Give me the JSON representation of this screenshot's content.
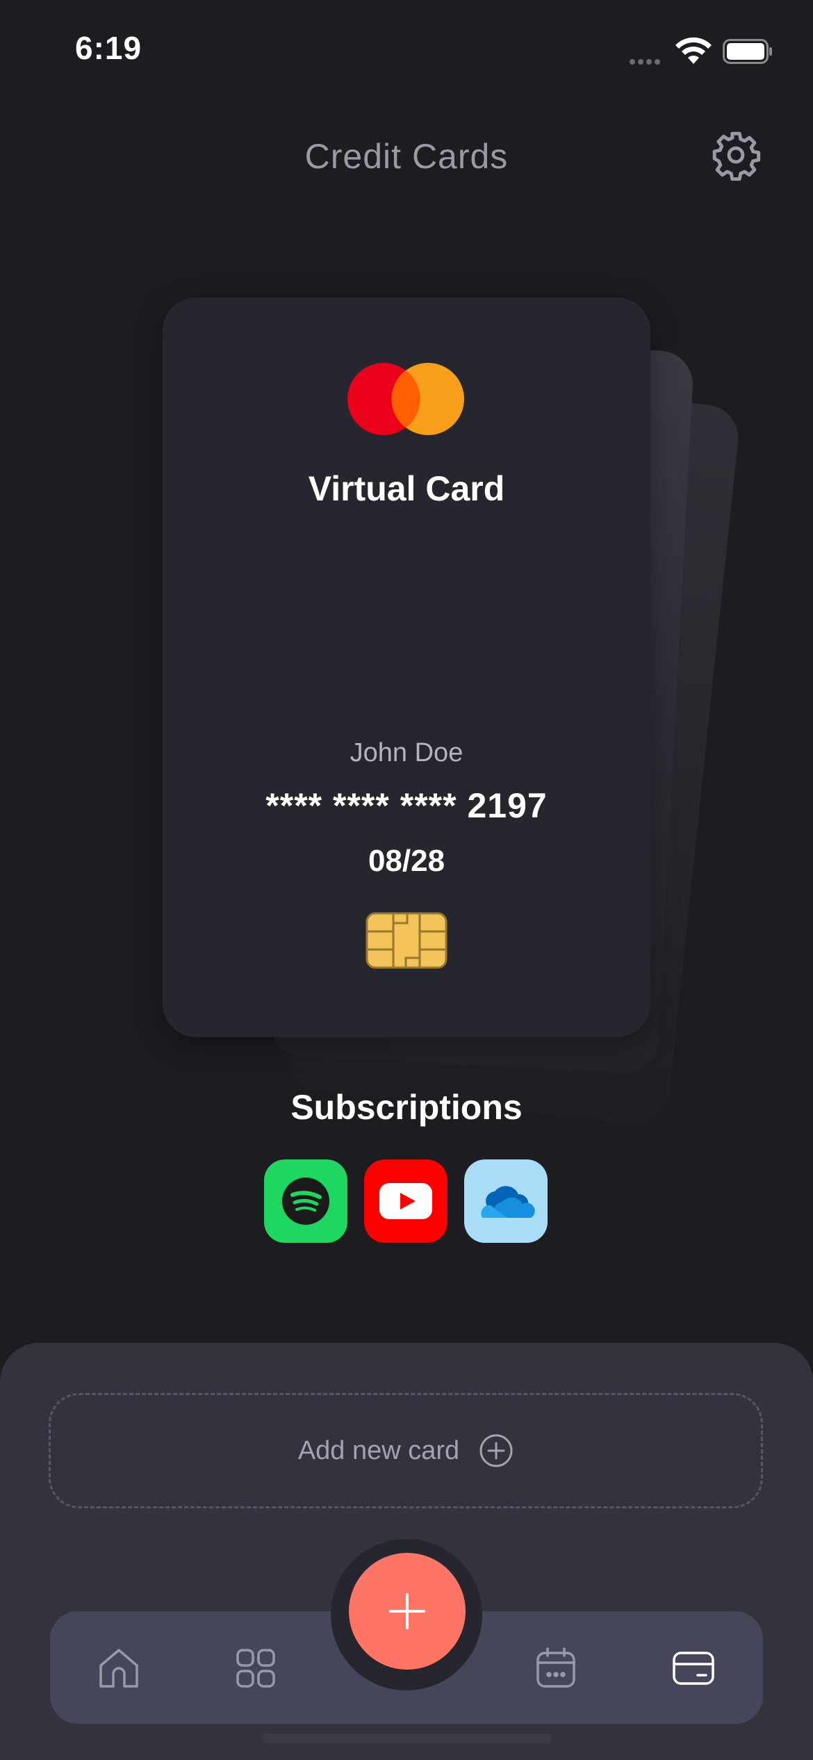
{
  "status_bar": {
    "time": "6:19"
  },
  "header": {
    "title": "Credit Cards",
    "settings_icon": "gear-icon"
  },
  "card": {
    "brand_icon": "mastercard-logo",
    "title": "Virtual Card",
    "holder": "John Doe",
    "number": "**** **** **** 2197",
    "expiry": "08/28",
    "chip_icon": "chip-icon"
  },
  "subscriptions": {
    "title": "Subscriptions",
    "items": [
      {
        "icon": "spotify-icon",
        "color": "#1ed760"
      },
      {
        "icon": "youtube-icon",
        "color": "#ff0000"
      },
      {
        "icon": "onedrive-icon",
        "color": "#a8dcf7"
      }
    ]
  },
  "add_card": {
    "label": "Add new card",
    "icon": "plus-circle-icon"
  },
  "tab_bar": {
    "items": [
      {
        "icon": "home-icon",
        "active": false
      },
      {
        "icon": "grid-icon",
        "active": false
      },
      {
        "icon": "calendar-icon",
        "active": false
      },
      {
        "icon": "credit-card-icon",
        "active": true
      }
    ],
    "fab_icon": "plus-icon",
    "fab_color": "#ff7565"
  },
  "colors": {
    "background": "#1c1c21",
    "card": "#26262e",
    "panel": "#33333e",
    "tab_bar": "#46465a",
    "accent": "#ff7565"
  }
}
